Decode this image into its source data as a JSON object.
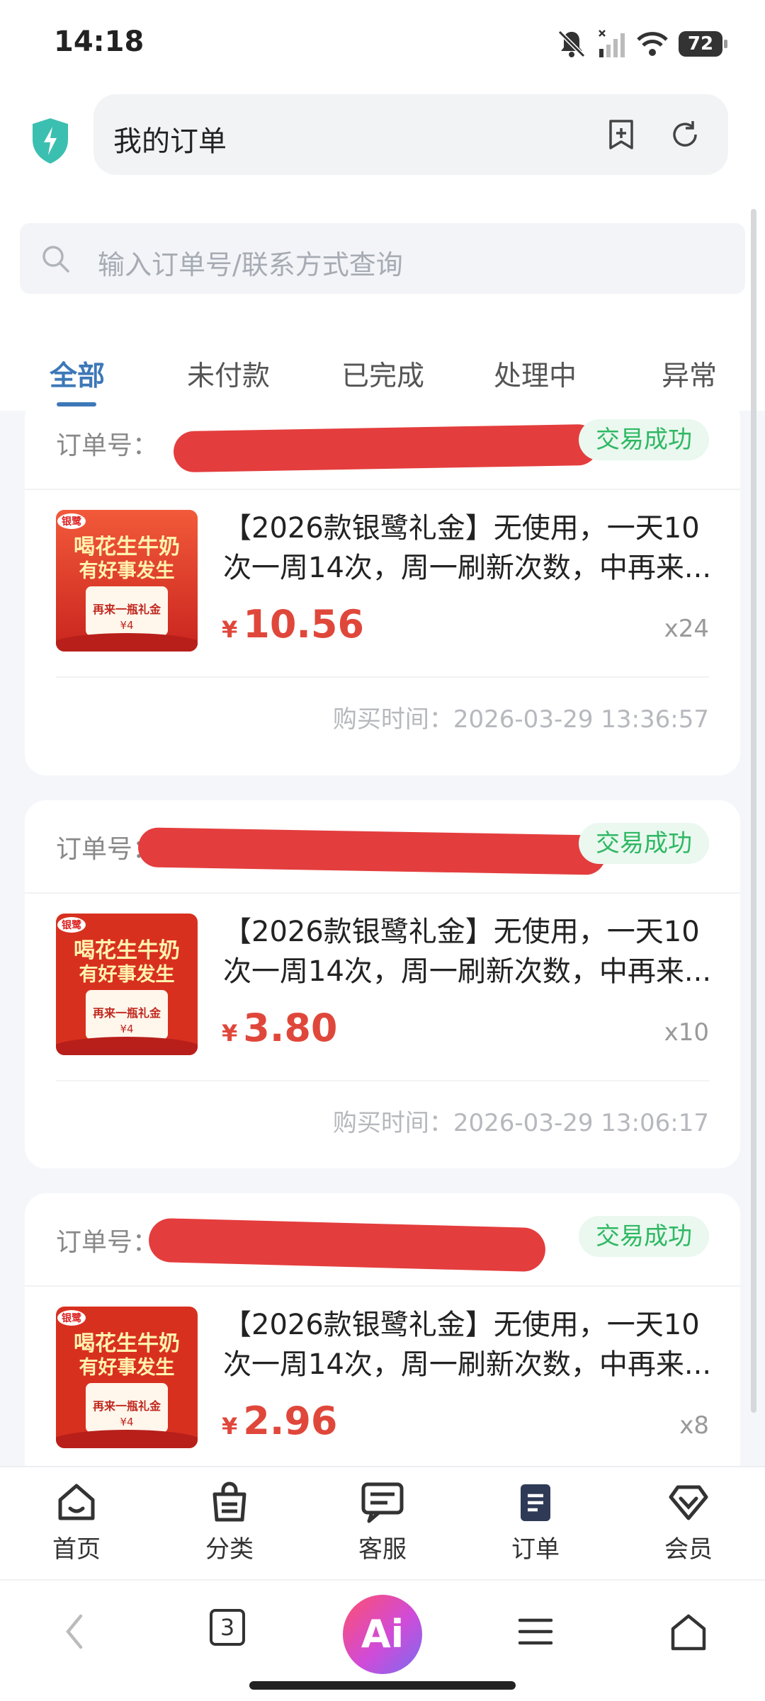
{
  "status_bar": {
    "time": "14:18",
    "battery": "72"
  },
  "address_bar": {
    "title": "我的订单"
  },
  "search": {
    "placeholder": "输入订单号/联系方式查询"
  },
  "tabs": [
    {
      "label": "全部",
      "active": true
    },
    {
      "label": "未付款",
      "active": false
    },
    {
      "label": "已完成",
      "active": false
    },
    {
      "label": "处理中",
      "active": false
    },
    {
      "label": "异常",
      "active": false
    }
  ],
  "orders": [
    {
      "order_label": "订单号：",
      "status": "交易成功",
      "title_line1": "【2026款银鹭礼金】无使用，一天10",
      "title_line2": "次一周14次，周一刷新次数，中再来...",
      "currency": "¥",
      "price": "10.56",
      "quantity": "x24",
      "purchase_time": "购买时间：2026-03-29 13:36:57"
    },
    {
      "order_label": "订单号：",
      "status": "交易成功",
      "title_line1": "【2026款银鹭礼金】无使用，一天10",
      "title_line2": "次一周14次，周一刷新次数，中再来...",
      "currency": "¥",
      "price": "3.80",
      "quantity": "x10",
      "purchase_time": "购买时间：2026-03-29 13:06:17"
    },
    {
      "order_label": "订单号：",
      "status": "交易成功",
      "title_line1": "【2026款银鹭礼金】无使用，一天10",
      "title_line2": "次一周14次，周一刷新次数，中再来...",
      "currency": "¥",
      "price": "2.96",
      "quantity": "x8",
      "purchase_time": ""
    }
  ],
  "product_image": {
    "brand": "银鹭",
    "headline_1": "喝花生牛奶",
    "headline_2": "有好事发生",
    "prize_text": "再来一瓶礼金",
    "value": "¥4"
  },
  "bottom_nav": [
    {
      "label": "首页",
      "icon": "home-icon"
    },
    {
      "label": "分类",
      "icon": "bag-icon"
    },
    {
      "label": "客服",
      "icon": "chat-icon"
    },
    {
      "label": "订单",
      "icon": "clipboard-icon",
      "active": true
    },
    {
      "label": "会员",
      "icon": "diamond-icon"
    }
  ],
  "browser_bar": {
    "tab_count": "3",
    "ai_label": "Ai"
  },
  "colors": {
    "accent": "#3d78b8",
    "price": "#e0473b",
    "success": "#2fb863",
    "redaction": "#e43d3d"
  }
}
